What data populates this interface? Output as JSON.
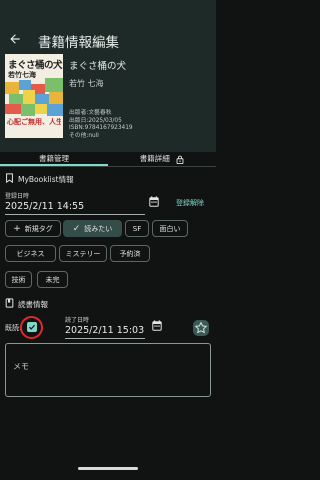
{
  "app_bar": {
    "title": "書籍情報編集",
    "back_icon": "arrow-back-icon"
  },
  "book": {
    "title": "まぐさ桶の犬",
    "author": "若竹 七海",
    "cover": {
      "title": "まぐさ桶の犬",
      "author": "若竹七海",
      "tagline": "心配ご無用、人生には、あなた次第でなんとかなる…"
    },
    "meta": [
      "出版者:文藝春秋",
      "出版日:2025/03/05",
      "ISBN:9784167923419",
      "その他:null"
    ]
  },
  "tabs": [
    {
      "label": "書籍管理",
      "active": true
    },
    {
      "label": "書籍詳細",
      "icon": "lock-icon"
    }
  ],
  "booklist": {
    "section_label": "MyBooklist情報",
    "registered_label": "登録日時",
    "registered_value": "2025/2/11 14:55",
    "remove_label": "登録解除",
    "new_tag_label": "新規タグ",
    "tags": [
      {
        "label": "読みたい",
        "selected": true
      },
      {
        "label": "SF",
        "selected": false
      },
      {
        "label": "面白い",
        "selected": false
      },
      {
        "label": "ビジネス",
        "selected": false
      },
      {
        "label": "ミステリー",
        "selected": false
      },
      {
        "label": "予約済",
        "selected": false
      },
      {
        "label": "技術",
        "selected": false
      },
      {
        "label": "未完",
        "selected": false
      }
    ]
  },
  "reading": {
    "section_label": "読書情報",
    "read_label": "既読:",
    "read_checked": true,
    "finished_label": "読了日時",
    "finished_value": "2025/2/11 15:03",
    "memo_placeholder": "メモ"
  },
  "colors": {
    "accent": "#7fd9c9",
    "highlight_ring": "#e02a2a",
    "background": "#111312",
    "header": "#1d2a28"
  }
}
